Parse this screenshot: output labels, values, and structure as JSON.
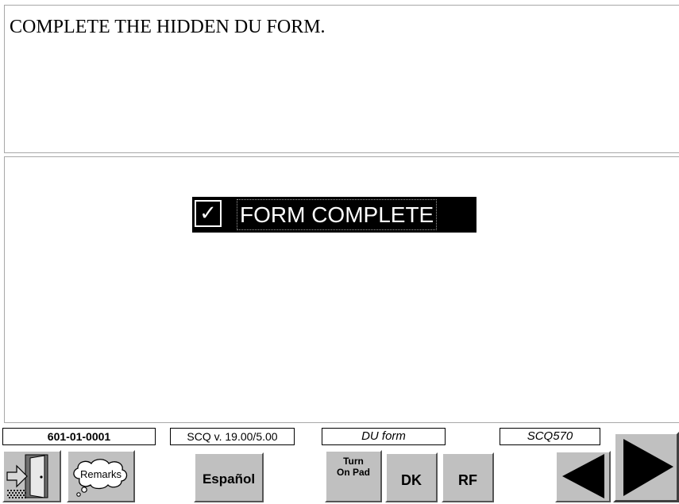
{
  "question": {
    "text": "COMPLETE THE HIDDEN DU FORM."
  },
  "answer": {
    "check_mark": "✓",
    "label": "FORM COMPLETE",
    "checked": true
  },
  "status_bar": {
    "case_id": "601-01-0001",
    "version": "SCQ v. 19.00/5.00",
    "form_name": "DU form",
    "item_name": "SCQ570"
  },
  "buttons": {
    "exit_icon": "exit-door-icon",
    "remarks_label": "Remarks",
    "remarks_icon": "thought-cloud-icon",
    "espanol_label": "Español",
    "turn_on_pad_label": "Turn\nOn Pad",
    "dk_label": "DK",
    "rf_label": "RF",
    "prev_icon": "left-triangle-icon",
    "next_icon": "right-triangle-icon"
  },
  "colors": {
    "selected_answer_background": "#000000",
    "selected_answer_text": "#ffffff",
    "button_face": "#c0c0c0"
  }
}
